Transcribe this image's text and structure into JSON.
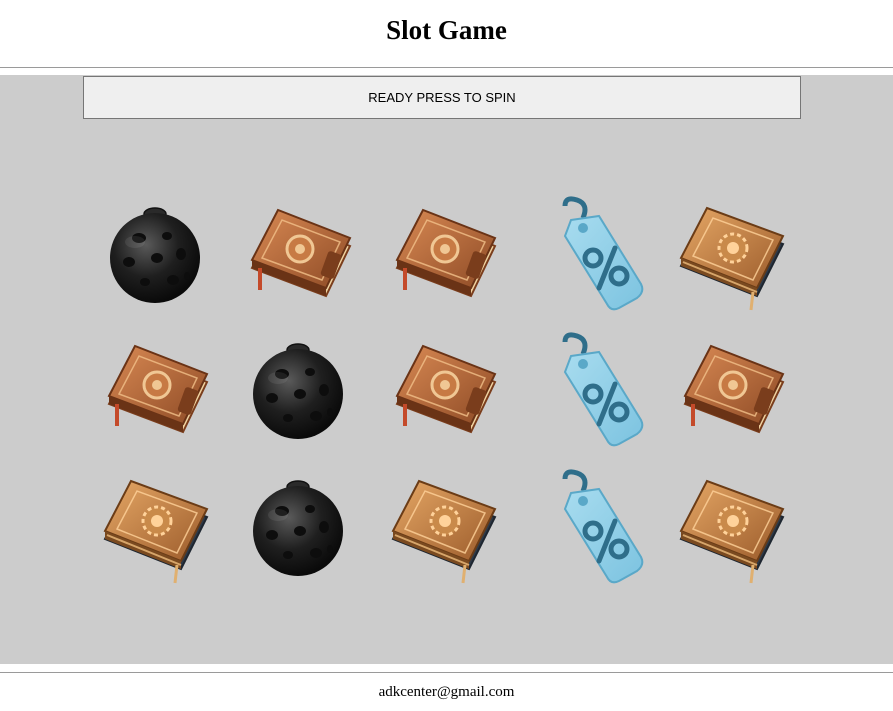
{
  "header": {
    "title": "Slot Game"
  },
  "status": {
    "message": "READY PRESS TO SPIN"
  },
  "reels": [
    [
      "bomb",
      "book-lock",
      "book-gear"
    ],
    [
      "book-lock",
      "bomb",
      "bomb"
    ],
    [
      "book-lock",
      "book-lock",
      "book-gear"
    ],
    [
      "tag",
      "tag",
      "tag"
    ],
    [
      "book-gear",
      "book-lock",
      "book-gear"
    ]
  ],
  "footer": {
    "email": "adkcenter@gmail.com"
  },
  "colors": {
    "board": "#cccccc",
    "status_bg": "#efefef",
    "bomb": "#1f1f1f",
    "book_lock": "#b8683a",
    "book_gear": "#c98a4a",
    "tag": "#7cc3e0"
  }
}
